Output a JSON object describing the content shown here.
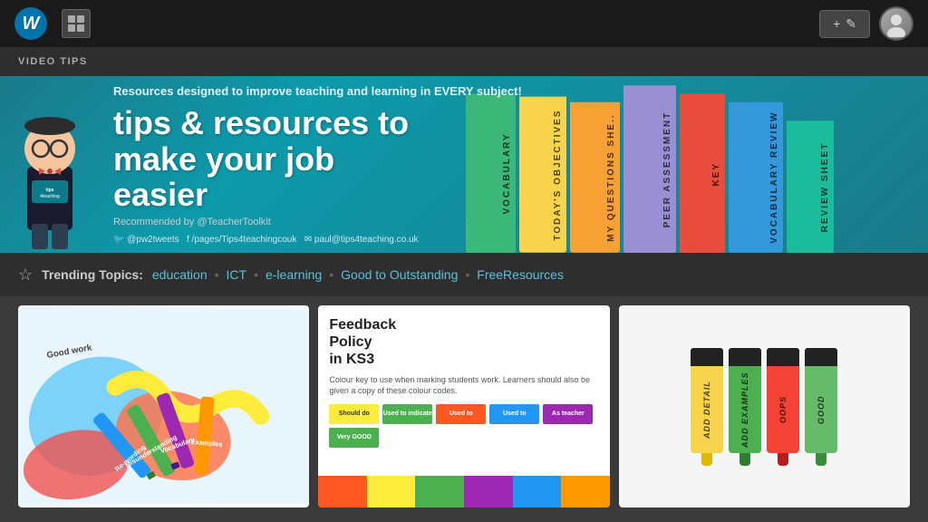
{
  "topbar": {
    "wp_logo": "W",
    "new_post_label": "+ ✎",
    "section_label": "VIDEO TIPS"
  },
  "banner": {
    "top_text": "Resources designed to improve teaching and learning in EVERY subject!",
    "main_title_line1": "tips & resources to",
    "main_title_line2": "make your job",
    "main_title_line3": "easier",
    "recommended": "Recommended by @TeacherToolkit",
    "social_twitter": "🐦 @pw2tweets",
    "social_facebook": "f /pages/Tips4teachingcouk",
    "social_email": "✉ paul@tips4teaching.co.uk",
    "logo_text": "tips\n4\nteaching\nco.uk"
  },
  "books": [
    {
      "label": "Vocabulary",
      "color": "#3bb878",
      "height": "90%"
    },
    {
      "label": "Today's Objectives",
      "color": "#f7d44c",
      "height": "85%"
    },
    {
      "label": "My Questions Sheet",
      "color": "#f7a034",
      "height": "80%"
    },
    {
      "label": "Peer Assessment Supp",
      "color": "#9b59b6",
      "height": "88%"
    },
    {
      "label": "Key",
      "color": "#e74c3c",
      "height": "92%"
    },
    {
      "label": "Vocabulary Review",
      "color": "#3498db",
      "height": "78%"
    },
    {
      "label": "Review Sheet",
      "color": "#2ecc71",
      "height": "72%"
    }
  ],
  "trending": {
    "label": "Trending Topics:",
    "topics": [
      "education",
      "ICT",
      "e-learning",
      "Good to Outstanding",
      "FreeResources"
    ]
  },
  "cards": [
    {
      "id": "card1",
      "alt": "Colorful highlighter markers abstract art"
    },
    {
      "id": "card2",
      "title": "Feedback\nPolicy\nin KS3",
      "subtitle": "Colour key to use when marking students work. Learners should also be given a copy of these colour codes.",
      "alt": "Feedback Policy in KS3"
    },
    {
      "id": "card3",
      "alt": "Marker pens with labels",
      "markers": [
        {
          "label": "ADD DETAIL",
          "color": "#f7d44c"
        },
        {
          "label": "ADD EXAMPLES",
          "color": "#3bb878"
        },
        {
          "label": "OOPS",
          "color": "#f7623b"
        },
        {
          "label": "GOOD",
          "color": "#4caf7d"
        }
      ]
    }
  ]
}
